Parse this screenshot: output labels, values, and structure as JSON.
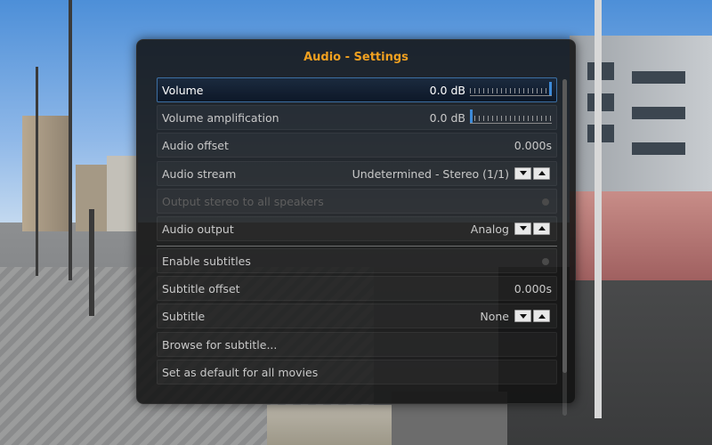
{
  "dialog": {
    "title": "Audio - Settings",
    "accent_color": "#f0a020",
    "focus_color": "#3d6fa3"
  },
  "settings": [
    {
      "label": "Volume",
      "value": "0.0 dB",
      "control": "slider",
      "level": 1.0,
      "state": "focused"
    },
    {
      "label": "Volume amplification",
      "value": "0.0 dB",
      "control": "slider",
      "level": 0.0,
      "state": "normal"
    },
    {
      "label": "Audio offset",
      "value": "0.000s",
      "control": "value",
      "state": "normal"
    },
    {
      "label": "Audio stream",
      "value": "Undetermined - Stereo (1/1)",
      "control": "spinner",
      "state": "normal"
    },
    {
      "label": "Output stereo to all speakers",
      "control": "radio",
      "checked": false,
      "state": "disabled"
    },
    {
      "label": "Audio output",
      "value": "Analog",
      "control": "spinner",
      "state": "normal"
    },
    {
      "label": "Enable subtitles",
      "control": "radio",
      "checked": false,
      "state": "normal"
    },
    {
      "label": "Subtitle offset",
      "value": "0.000s",
      "control": "value",
      "state": "normal"
    },
    {
      "label": "Subtitle",
      "value": "None",
      "control": "spinner",
      "state": "normal"
    },
    {
      "label": "Browse for subtitle...",
      "control": "button",
      "state": "normal"
    },
    {
      "label": "Set as default for all movies",
      "control": "button",
      "state": "normal"
    }
  ],
  "icons": {
    "spinner_down": "chevron-down-icon",
    "spinner_up": "chevron-up-icon"
  }
}
